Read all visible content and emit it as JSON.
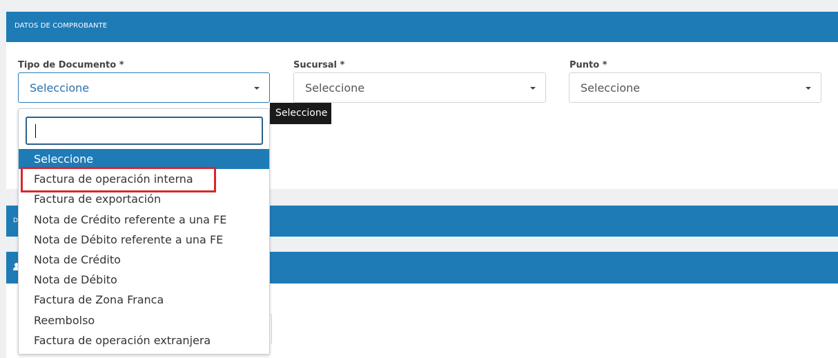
{
  "section1": {
    "title": "DATOS DE COMPROBANTE"
  },
  "section2": {
    "title": "D"
  },
  "fields": {
    "tipo_documento": {
      "label": "Tipo de Documento *",
      "value": "Seleccione"
    },
    "sucursal": {
      "label": "Sucursal *",
      "value": "Seleccione"
    },
    "punto": {
      "label": "Punto *",
      "value": "Seleccione"
    }
  },
  "dropdown": {
    "search_value": "",
    "options": [
      "Seleccione",
      "Factura de operación interna",
      "Factura de exportación",
      "Nota de Crédito referente a una FE",
      "Nota de Débito referente a una FE",
      "Nota de Crédito",
      "Nota de Débito",
      "Factura de Zona Franca",
      "Reembolso",
      "Factura de operación extranjera"
    ],
    "highlighted_index": 0,
    "marked_option": "Factura de operación interna"
  },
  "tooltip": {
    "text": "Seleccione"
  },
  "colors": {
    "header_blue": "#1f7bb6",
    "highlight_blue": "#1f7bb6",
    "annotation_red": "#d9262c"
  },
  "icons": {
    "section3": "user-icon"
  }
}
